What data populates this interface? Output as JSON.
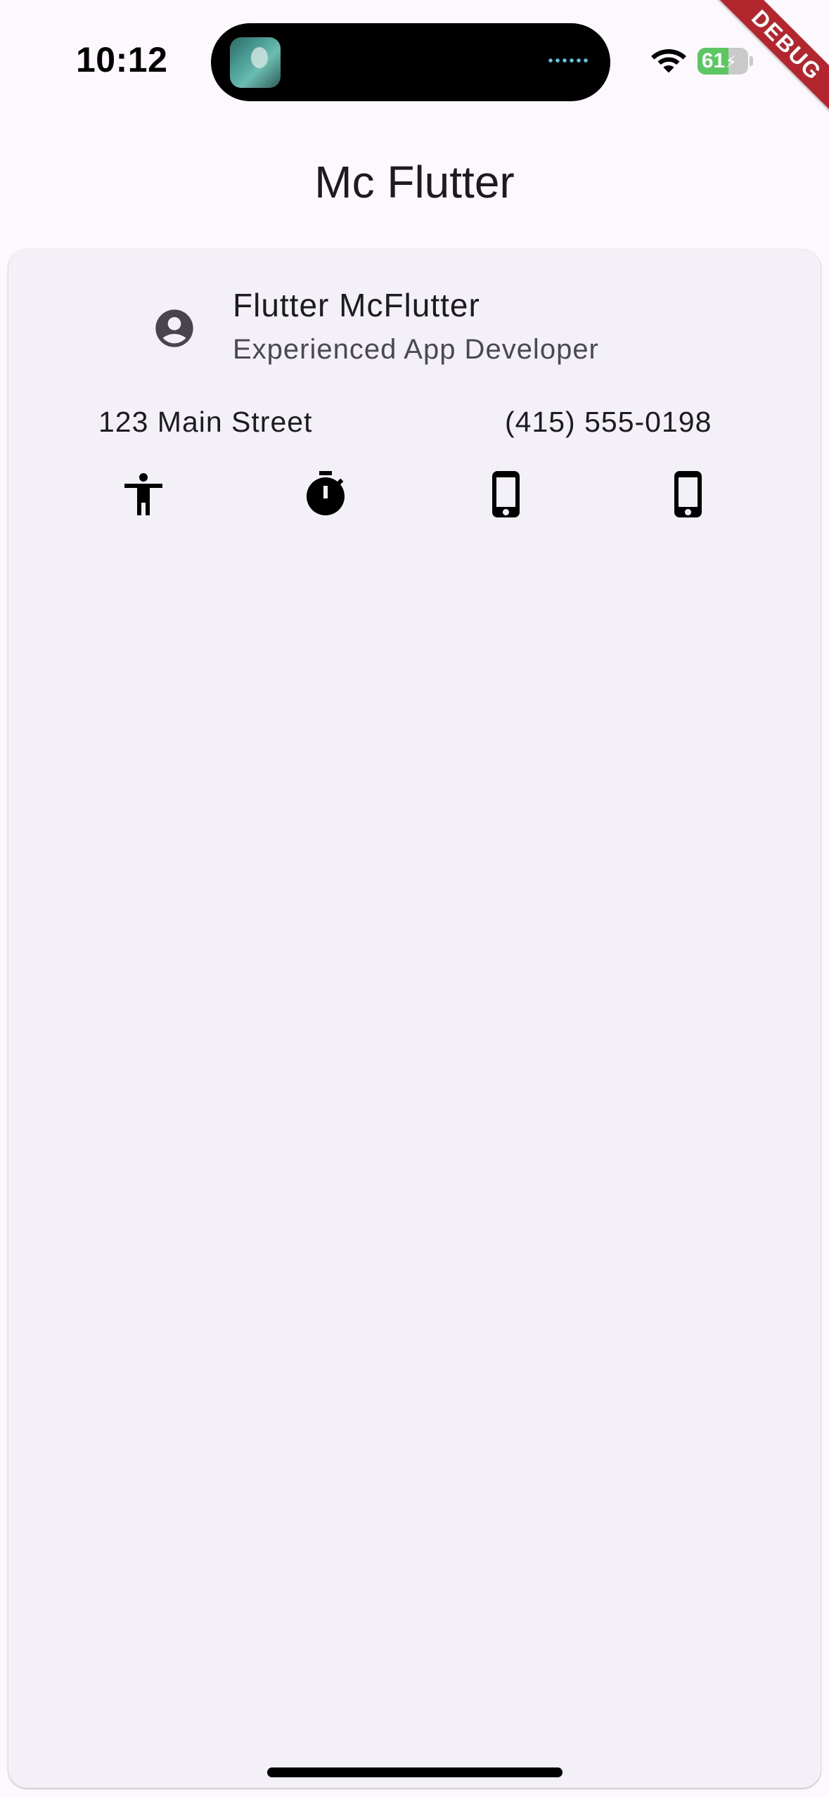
{
  "status_bar": {
    "time": "10:12",
    "battery_percent": "61",
    "battery_level": 0.61,
    "charging": true
  },
  "debug_banner": {
    "label": "DEBUG"
  },
  "app_bar": {
    "title": "Mc Flutter"
  },
  "profile": {
    "name": "Flutter McFlutter",
    "role": "Experienced App Developer",
    "address": "123 Main Street",
    "phone": "(415) 555-0198",
    "icons": [
      "accessibility-icon",
      "timer-icon",
      "phone-android-icon",
      "phone-iphone-icon"
    ]
  },
  "colors": {
    "background": "#fdf8fd",
    "card": "#f4f0f8",
    "battery_green": "#5bc761",
    "debug_red": "#b3262d"
  }
}
